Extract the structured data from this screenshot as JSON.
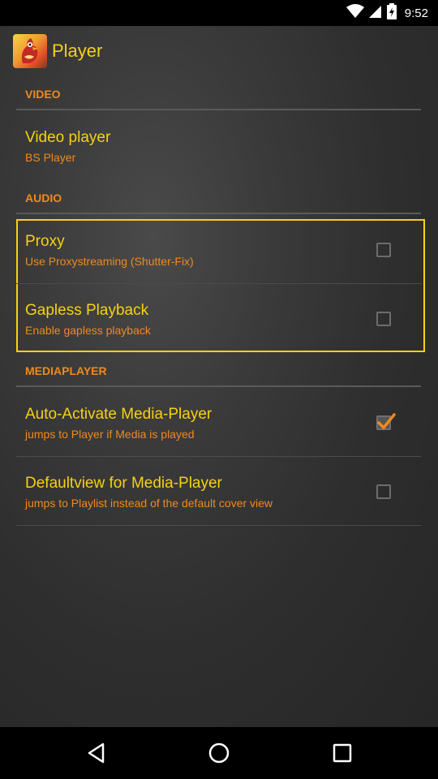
{
  "status_bar": {
    "time": "9:52"
  },
  "app_bar": {
    "title": "Player"
  },
  "sections": [
    {
      "header": "VIDEO"
    },
    {
      "header": "AUDIO"
    },
    {
      "header": "MEDIAPLAYER"
    }
  ],
  "preferences": {
    "video_player": {
      "title": "Video player",
      "summary": "BS Player"
    },
    "proxy": {
      "title": "Proxy",
      "summary": "Use Proxystreaming (Shutter-Fix)",
      "checked": false
    },
    "gapless": {
      "title": "Gapless Playback",
      "summary": "Enable gapless playback",
      "checked": false
    },
    "auto_activate": {
      "title": "Auto-Activate Media-Player",
      "summary": "jumps to Player if Media is played",
      "checked": true
    },
    "defaultview": {
      "title": "Defaultview for Media-Player",
      "summary": "jumps to Playlist instead of the default cover view",
      "checked": false
    }
  },
  "colors": {
    "title": "#f5d20f",
    "accent": "#ef8a1e",
    "focus_border": "#f5d20f"
  },
  "icons": {
    "status": [
      "wifi-icon",
      "signal-icon",
      "battery-charging-icon"
    ],
    "nav": [
      "back-icon",
      "home-icon",
      "recents-icon"
    ]
  }
}
